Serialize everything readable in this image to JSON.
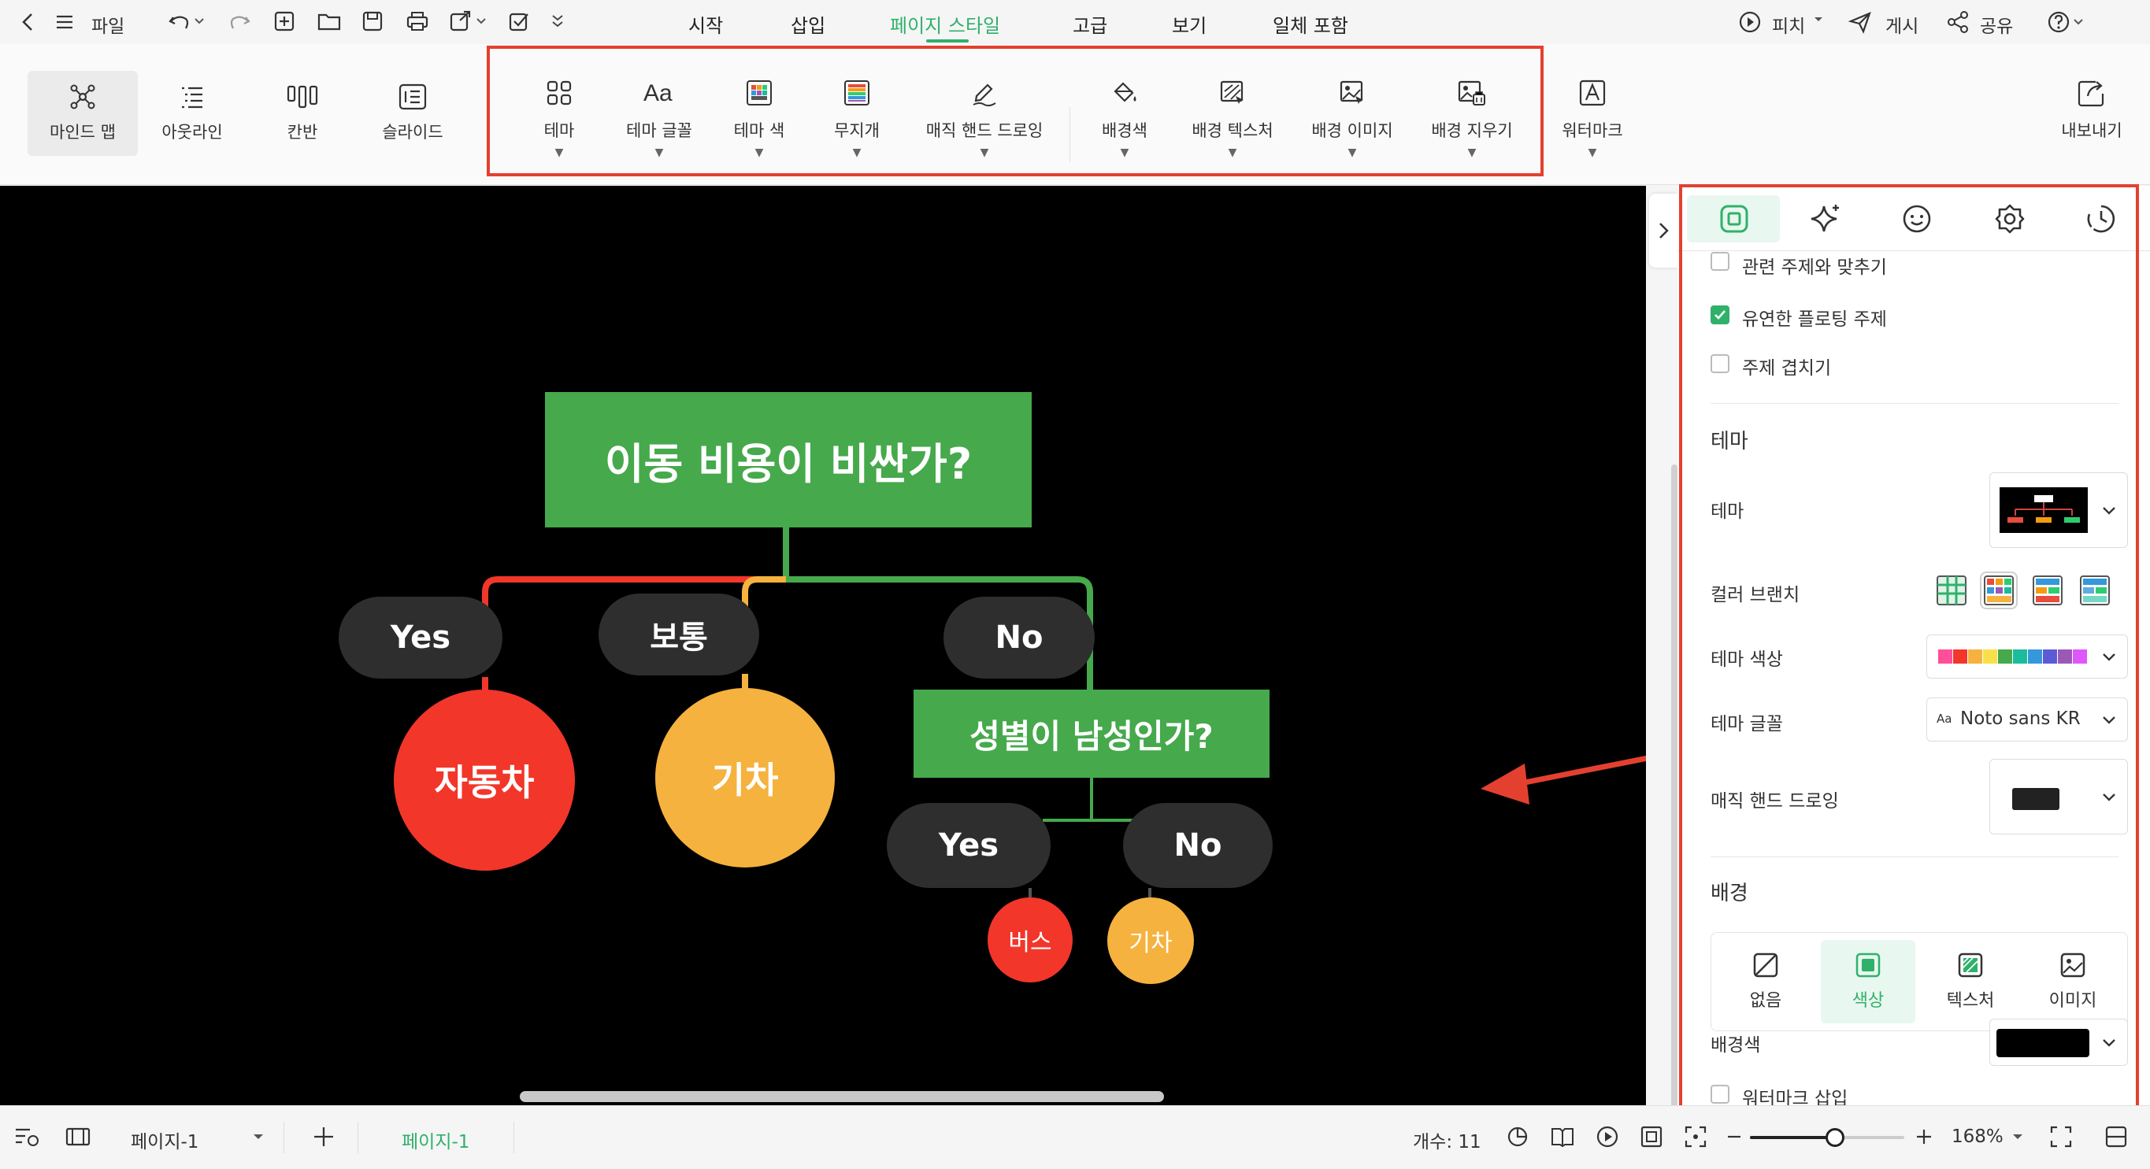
{
  "menubar": {
    "file_label": "파일",
    "menus": [
      "시작",
      "삽입",
      "페이지 스타일",
      "고급",
      "보기",
      "일체 포함"
    ],
    "active_menu": "페이지 스타일",
    "pitch_label": "피치",
    "publish_label": "게시",
    "share_label": "공유"
  },
  "ribbon": {
    "views": [
      {
        "label": "마인드 맵",
        "icon": "mindmap-icon"
      },
      {
        "label": "아웃라인",
        "icon": "outline-icon"
      },
      {
        "label": "칸반",
        "icon": "kanban-icon"
      },
      {
        "label": "슬라이드",
        "icon": "slide-icon"
      }
    ],
    "tools": [
      {
        "label": "테마",
        "icon": "theme-icon"
      },
      {
        "label": "테마 글꼴",
        "icon": "font-icon"
      },
      {
        "label": "테마 색",
        "icon": "theme-color-icon"
      },
      {
        "label": "무지개",
        "icon": "rainbow-icon"
      },
      {
        "label": "매직 핸드 드로잉",
        "icon": "magic-hand-drawing-icon"
      },
      {
        "label": "배경색",
        "icon": "paint-bucket-icon"
      },
      {
        "label": "배경 텍스처",
        "icon": "texture-icon"
      },
      {
        "label": "배경 이미지",
        "icon": "background-image-icon"
      },
      {
        "label": "배경 지우기",
        "icon": "erase-background-icon"
      }
    ],
    "watermark_label": "워터마크",
    "export_label": "내보내기"
  },
  "mindmap": {
    "root": "이동 비용이 비싼가?",
    "yes1": "Yes",
    "medium": "보통",
    "no1": "No",
    "car": "자동차",
    "train1": "기차",
    "gender": "성별이 남성인가?",
    "yes2": "Yes",
    "no2": "No",
    "bus": "버스",
    "train2": "기차"
  },
  "colors": {
    "green": "#46a94c",
    "red": "#f2362a",
    "orange": "#f5b23e",
    "pill": "#2e2e2e",
    "highlight": "#e4402f",
    "accent": "#2fb16a"
  },
  "panel": {
    "tabs": [
      "page-style-tab-icon",
      "ai-sparkle-tab-icon",
      "sticker-tab-icon",
      "settings-tab-icon",
      "history-tab-icon"
    ],
    "options": [
      {
        "label": "관련 주제와 맞추기",
        "checked": false
      },
      {
        "label": "유연한 플로팅 주제",
        "checked": true
      },
      {
        "label": "주제 겹치기",
        "checked": false
      }
    ],
    "theme_section": "테마",
    "theme_label": "테마",
    "color_branch_label": "컬러 브랜치",
    "theme_color_label": "테마 색상",
    "theme_font_label": "테마 글꼴",
    "theme_font_value": "Noto sans KR",
    "theme_font_prefix": "Aa",
    "magic_drawing_label": "매직 핸드 드로잉",
    "background_section": "배경",
    "bg_options": [
      "없음",
      "색상",
      "텍스처",
      "이미지"
    ],
    "bg_selected": "색상",
    "bg_color_label": "배경색",
    "bg_color_value": "#000000",
    "watermark_insert_label": "워터마크 삽입"
  },
  "status": {
    "page_select": "페이지-1",
    "page_tab": "페이지-1",
    "count": "개수: 11",
    "zoom": "168%",
    "zoom_level_fraction": 0.55
  }
}
